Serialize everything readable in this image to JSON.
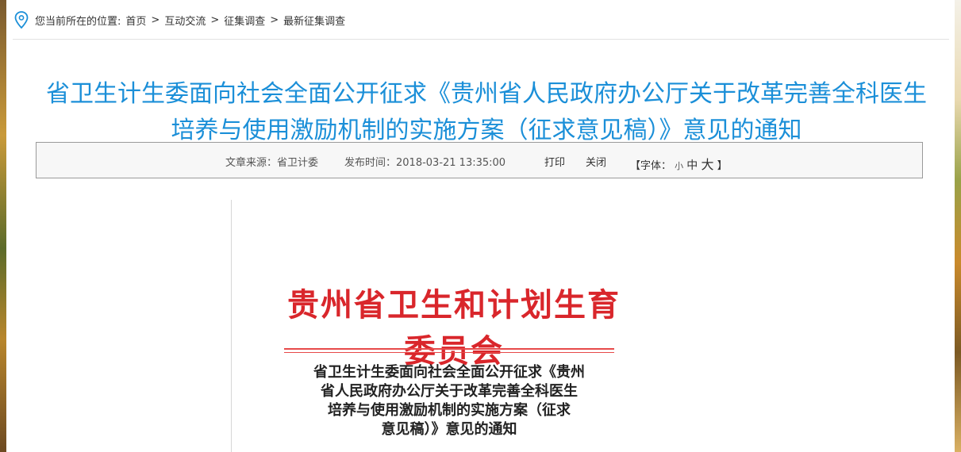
{
  "breadcrumb": {
    "prefix": "您当前所在的位置:",
    "items": [
      "首页",
      "互动交流",
      "征集调查",
      "最新征集调查"
    ],
    "separator": ">"
  },
  "article": {
    "title_line1": "省卫生计生委面向社会全面公开征求《贵州省人民政府办公厅关于改革完善全科医生",
    "title_line2": "培养与使用激励机制的实施方案（征求意见稿）》意见的通知",
    "source": "文章来源：省卫计委",
    "publish_time": "发布时间：2018-03-21 13:35:00",
    "print_label": "打印",
    "close_label": "关闭",
    "font_size_label": "【字体：",
    "font_small": "小",
    "font_medium": "中",
    "font_large": "大",
    "font_size_end": "】"
  },
  "document_image": {
    "red_header": "贵州省卫生和计划生育委员会",
    "title_lines": [
      "省卫生计生委面向社会全面公开征求《贵州",
      "省人民政府办公厅关于改革完善全科医生",
      "培养与使用激励机制的实施方案（征求",
      "意见稿）》意见的通知"
    ]
  },
  "colors": {
    "title": "#1b8fd8",
    "red_header": "#d9262b",
    "pin_icon": "#1b8fd8"
  },
  "icons": {
    "location": "location-pin-icon"
  }
}
